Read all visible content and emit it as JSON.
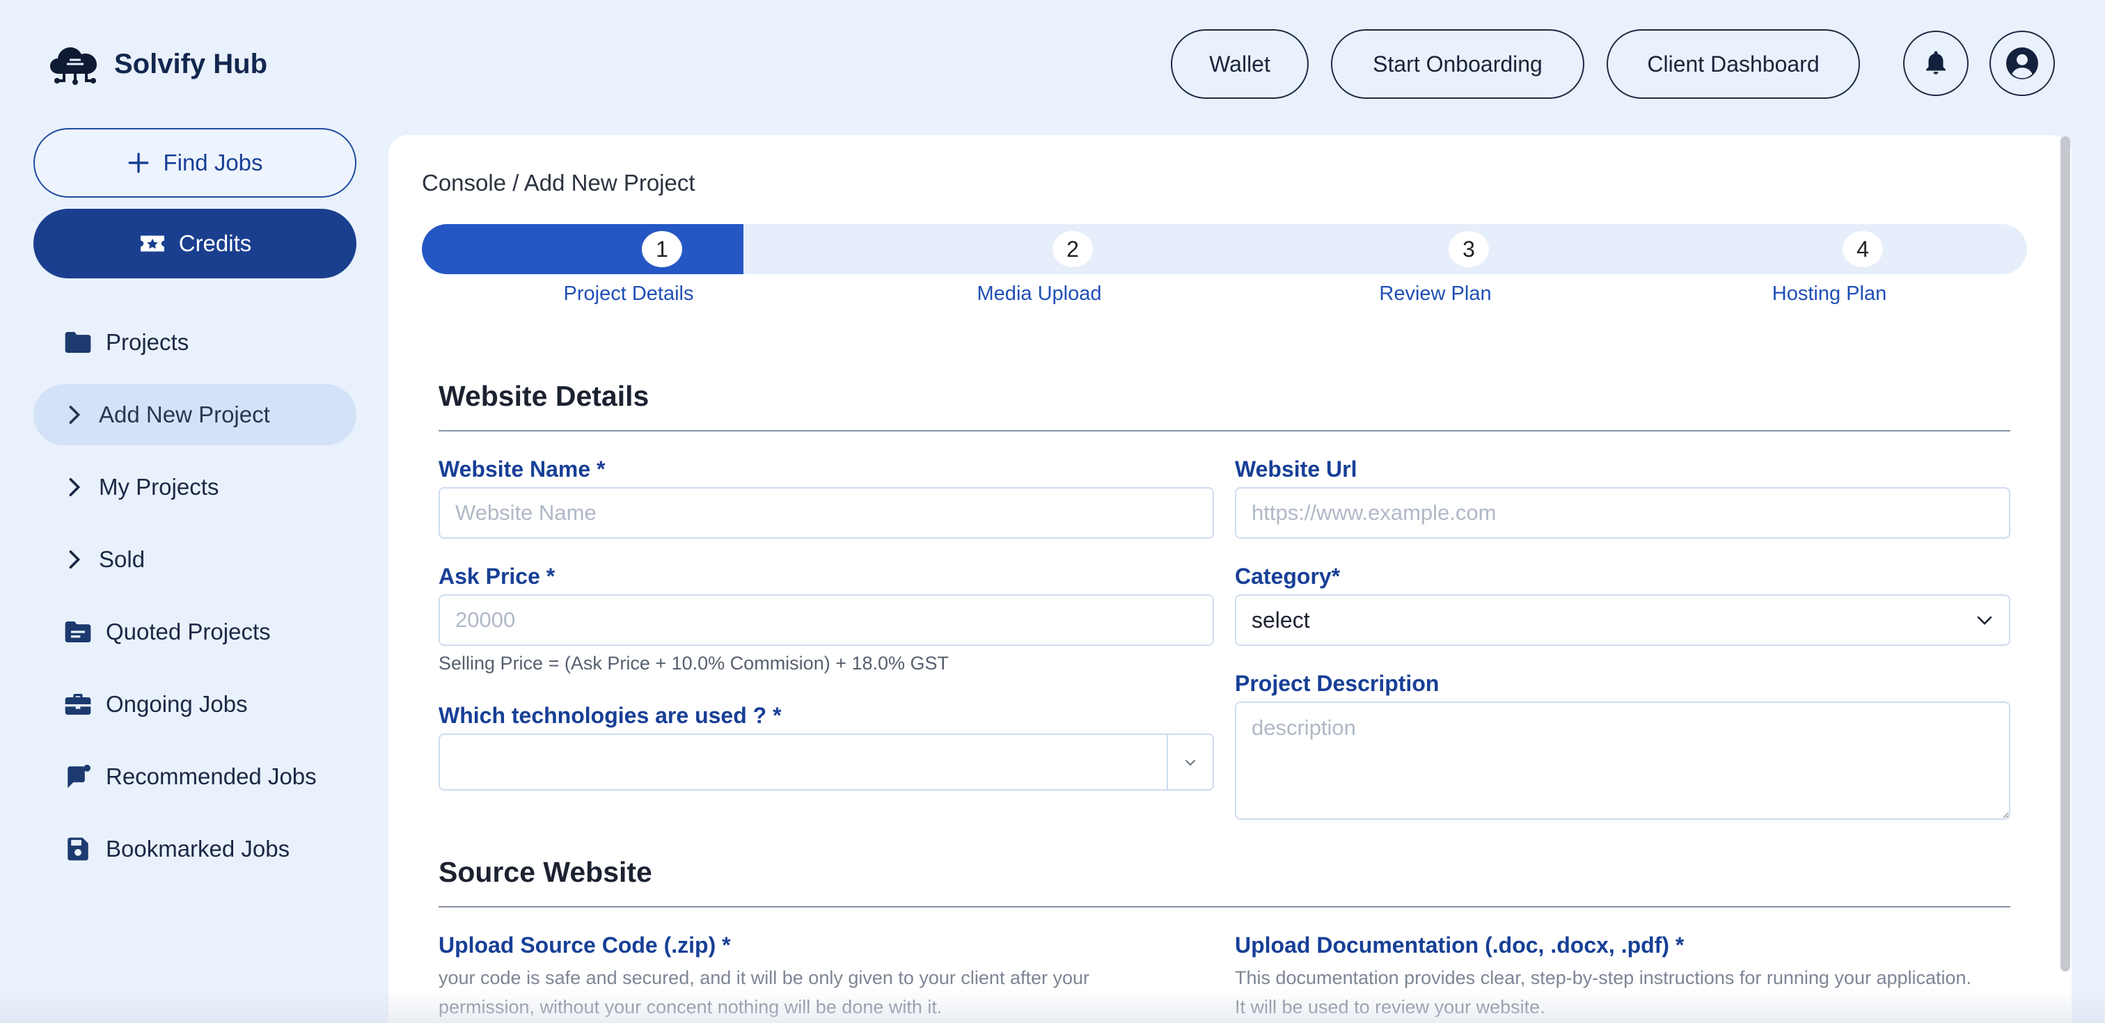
{
  "app": {
    "name": "Solvify Hub"
  },
  "header": {
    "wallet": "Wallet",
    "start_onboarding": "Start Onboarding",
    "client_dashboard": "Client Dashboard"
  },
  "sidebar": {
    "find_jobs": "Find Jobs",
    "credits": "Credits",
    "items": [
      {
        "label": "Projects",
        "icon": "folder-icon"
      },
      {
        "label": "Add New Project",
        "icon": "chevron-right-icon"
      },
      {
        "label": "My Projects",
        "icon": "chevron-right-icon"
      },
      {
        "label": "Sold",
        "icon": "chevron-right-icon"
      },
      {
        "label": "Quoted Projects",
        "icon": "quote-folder-icon"
      },
      {
        "label": "Ongoing Jobs",
        "icon": "briefcase-icon"
      },
      {
        "label": "Recommended Jobs",
        "icon": "chat-flag-icon"
      },
      {
        "label": "Bookmarked Jobs",
        "icon": "save-icon"
      }
    ]
  },
  "main": {
    "breadcrumb": "Console / Add New Project",
    "steps": [
      {
        "num": "1",
        "label": "Project Details"
      },
      {
        "num": "2",
        "label": "Media Upload"
      },
      {
        "num": "3",
        "label": "Review Plan"
      },
      {
        "num": "4",
        "label": "Hosting Plan"
      }
    ],
    "website_details": {
      "title": "Website Details",
      "website_name_label": "Website Name *",
      "website_name_placeholder": "Website Name",
      "website_url_label": "Website Url",
      "website_url_placeholder": "https://www.example.com",
      "ask_price_label": "Ask Price *",
      "ask_price_placeholder": "20000",
      "category_label": "Category*",
      "category_value": "select",
      "price_hint": "Selling Price = (Ask Price + 10.0% Commision) + 18.0% GST",
      "tech_label": "Which technologies are used ? *",
      "description_label": "Project Description",
      "description_placeholder": "description"
    },
    "source_website": {
      "title": "Source Website",
      "source_code_label": "Upload Source Code (.zip) *",
      "source_code_desc": "your code is safe and secured, and it will be only given to your client after your permission, without your concent nothing will be done with it.",
      "docs_label": "Upload Documentation (.doc, .docx, .pdf) *",
      "docs_desc": "This documentation provides clear, step-by-step instructions for running your application. It will be used to review your website."
    }
  },
  "colors": {
    "accent": "#2557c4",
    "navy": "#1a3f8f",
    "label_blue": "#173f96",
    "page_bg": "#e9f1fc"
  }
}
